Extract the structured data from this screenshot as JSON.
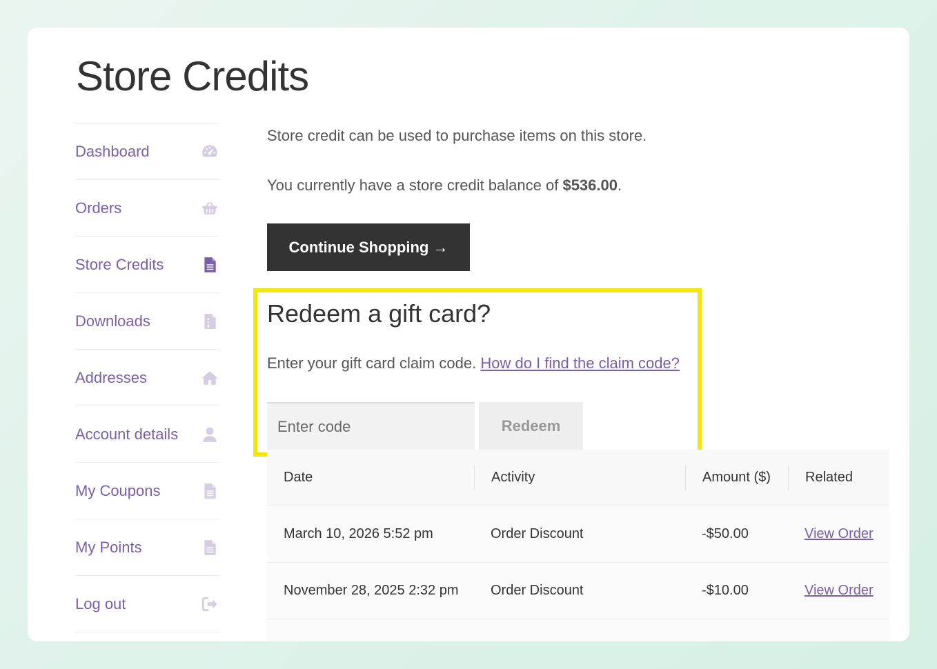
{
  "page": {
    "title": "Store Credits"
  },
  "sidebar": {
    "items": [
      {
        "label": "Dashboard",
        "icon": "dashboard-gauge-icon"
      },
      {
        "label": "Orders",
        "icon": "basket-icon"
      },
      {
        "label": "Store Credits",
        "icon": "document-icon",
        "active": true
      },
      {
        "label": "Downloads",
        "icon": "file-download-icon"
      },
      {
        "label": "Addresses",
        "icon": "home-icon"
      },
      {
        "label": "Account details",
        "icon": "user-icon"
      },
      {
        "label": "My Coupons",
        "icon": "document-icon"
      },
      {
        "label": "My Points",
        "icon": "document-icon"
      },
      {
        "label": "Log out",
        "icon": "logout-icon"
      }
    ]
  },
  "main": {
    "intro": "Store credit can be used to purchase items on this store.",
    "balance_prefix": "You currently have a store credit balance of ",
    "balance_amount": "$536.00",
    "balance_suffix": ".",
    "continue_label": "Continue Shopping →"
  },
  "gift": {
    "title": "Redeem a gift card?",
    "text": "Enter your gift card claim code. ",
    "link": "How do I find the claim code?",
    "placeholder": "Enter code",
    "redeem_label": "Redeem"
  },
  "table": {
    "headers": [
      "Date",
      "Activity",
      "Amount ($)",
      "Related"
    ],
    "rows": [
      {
        "date": "March 10, 2026 5:52 pm",
        "activity": "Order Discount",
        "amount": "-$50.00",
        "related": "View Order"
      },
      {
        "date": "November 28, 2025 2:32 pm",
        "activity": "Order Discount",
        "amount": "-$10.00",
        "related": "View Order"
      }
    ]
  },
  "colors": {
    "accent": "#7b5ea8",
    "active_icon": "#7b5ea8",
    "inactive_icon": "#d6cde3",
    "button_dark": "#333333",
    "highlight": "#f3e60a"
  }
}
